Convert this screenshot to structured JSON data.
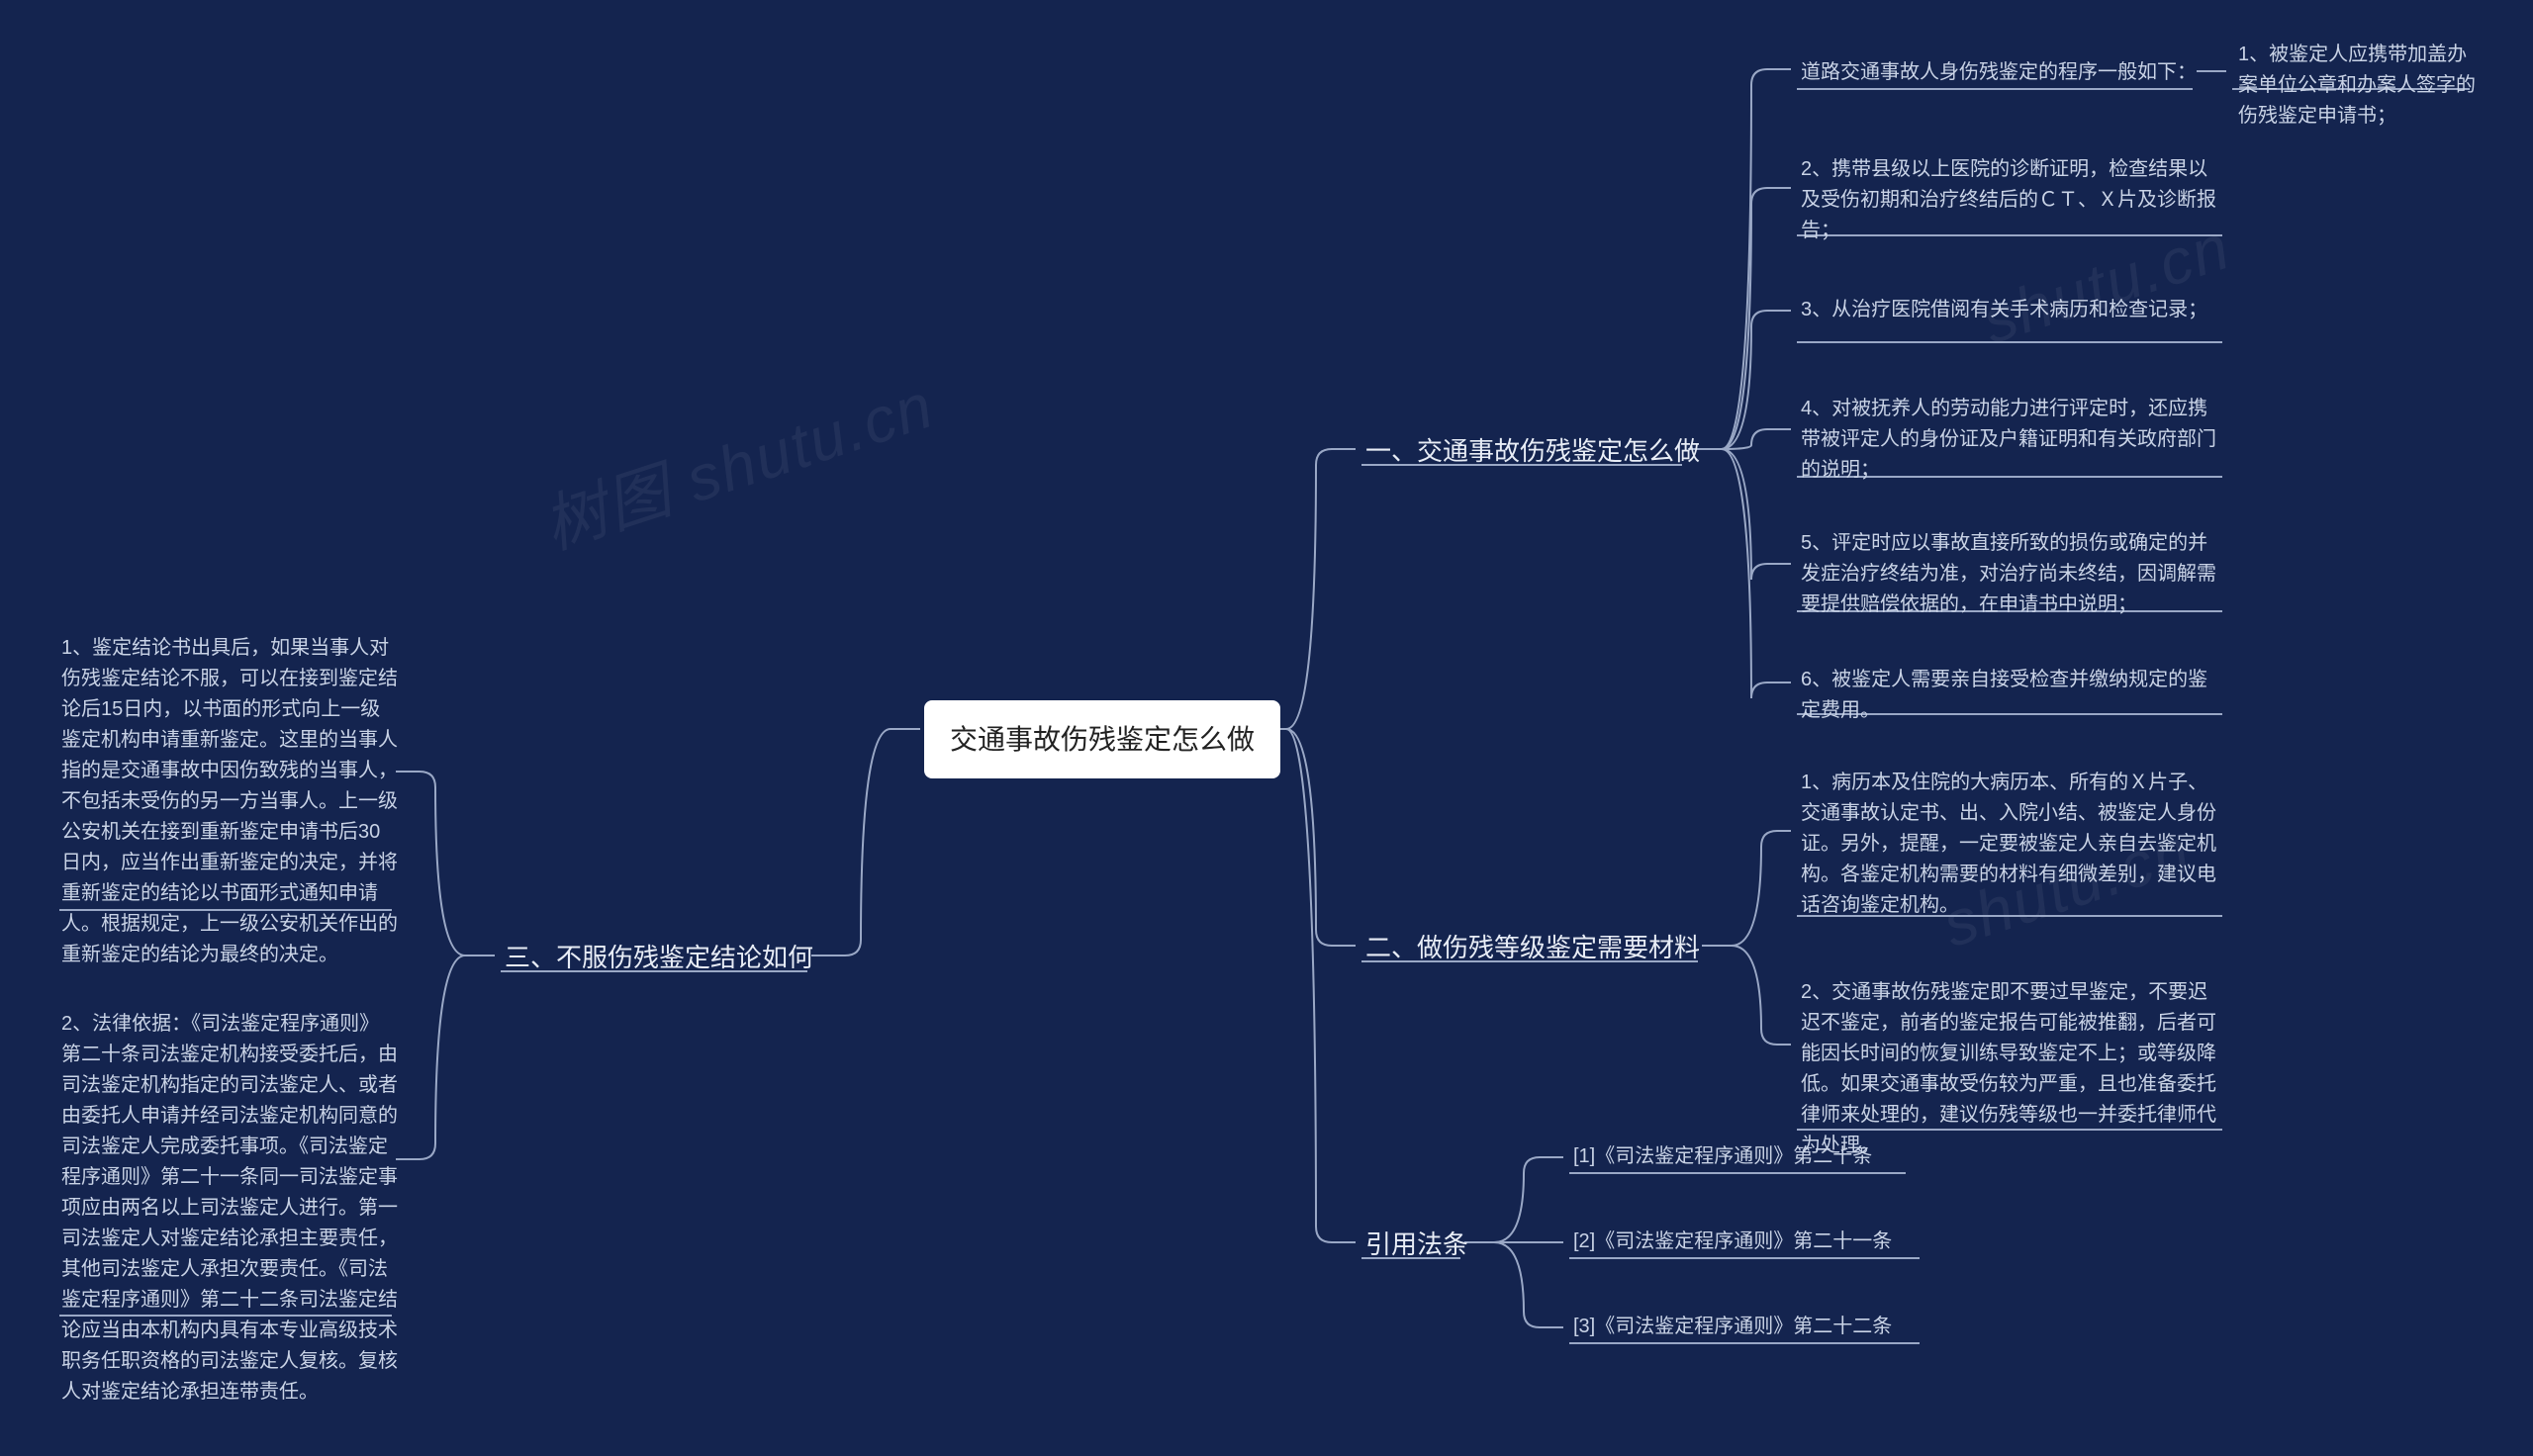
{
  "root": "交通事故伤残鉴定怎么做",
  "branch1": {
    "title": "一、交通事故伤残鉴定怎么做",
    "n1": "道路交通事故人身伤残鉴定的程序一般如下：",
    "n1_1": "1、被鉴定人应携带加盖办案单位公章和办案人签字的伤残鉴定申请书；",
    "n2": "2、携带县级以上医院的诊断证明，检查结果以及受伤初期和治疗终结后的ＣＴ、Ｘ片及诊断报告；",
    "n3": "3、从治疗医院借阅有关手术病历和检查记录；",
    "n4": "4、对被抚养人的劳动能力进行评定时，还应携带被评定人的身份证及户籍证明和有关政府部门的说明；",
    "n5": "5、评定时应以事故直接所致的损伤或确定的并发症治疗终结为准，对治疗尚未终结，因调解需要提供赔偿依据的，在申请书中说明；",
    "n6": "6、被鉴定人需要亲自接受检查并缴纳规定的鉴定费用。"
  },
  "branch2": {
    "title": "二、做伤残等级鉴定需要材料",
    "n1": "1、病历本及住院的大病历本、所有的Ｘ片子、交通事故认定书、出、入院小结、被鉴定人身份证。另外，提醒，一定要被鉴定人亲自去鉴定机构。各鉴定机构需要的材料有细微差别，建议电话咨询鉴定机构。",
    "n2": "2、交通事故伤残鉴定即不要过早鉴定，不要迟迟不鉴定，前者的鉴定报告可能被推翻，后者可能因长时间的恢复训练导致鉴定不上；或等级降低。如果交通事故受伤较为严重，且也准备委托律师来处理的，建议伤残等级也一并委托律师代为处理。"
  },
  "branch3": {
    "title": "三、不服伤残鉴定结论如何",
    "n1": "1、鉴定结论书出具后，如果当事人对伤残鉴定结论不服，可以在接到鉴定结论后15日内，以书面的形式向上一级鉴定机构申请重新鉴定。这里的当事人指的是交通事故中因伤致残的当事人，不包括未受伤的另一方当事人。上一级公安机关在接到重新鉴定申请书后30日内，应当作出重新鉴定的决定，并将重新鉴定的结论以书面形式通知申请人。根据规定，上一级公安机关作出的重新鉴定的结论为最终的决定。",
    "n2": "2、法律依据：《司法鉴定程序通则》第二十条司法鉴定机构接受委托后，由司法鉴定机构指定的司法鉴定人、或者由委托人申请并经司法鉴定机构同意的司法鉴定人完成委托事项。《司法鉴定程序通则》第二十一条同一司法鉴定事项应由两名以上司法鉴定人进行。第一司法鉴定人对鉴定结论承担主要责任，其他司法鉴定人承担次要责任。《司法鉴定程序通则》第二十二条司法鉴定结论应当由本机构内具有本专业高级技术职务任职资格的司法鉴定人复核。复核人对鉴定结论承担连带责任。"
  },
  "branch4": {
    "title": "引用法条",
    "n1": "[1]《司法鉴定程序通则》第二十条",
    "n2": "[2]《司法鉴定程序通则》第二十一条",
    "n3": "[3]《司法鉴定程序通则》第二十二条"
  },
  "watermarks": {
    "w1": "树图 shutu.cn",
    "w2": "shutu.cn",
    "w3": "shutu.cn"
  }
}
